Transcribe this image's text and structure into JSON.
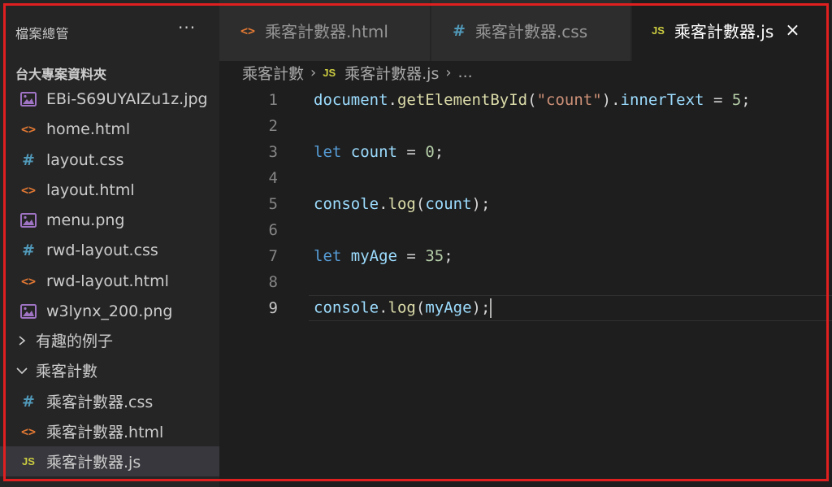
{
  "sidebar": {
    "title": "檔案總管",
    "more_label": "···",
    "root_folder": "台大專案資料夾",
    "items": [
      {
        "label": "EBi-S69UYAIZu1z.jpg",
        "type": "image"
      },
      {
        "label": "home.html",
        "type": "html"
      },
      {
        "label": "layout.css",
        "type": "css"
      },
      {
        "label": "layout.html",
        "type": "html"
      },
      {
        "label": "menu.png",
        "type": "image"
      },
      {
        "label": "rwd-layout.css",
        "type": "css"
      },
      {
        "label": "rwd-layout.html",
        "type": "html"
      },
      {
        "label": "w3lynx_200.png",
        "type": "image"
      },
      {
        "label": "有趣的例子",
        "type": "folder-collapsed"
      },
      {
        "label": "乘客計數",
        "type": "folder-expanded"
      },
      {
        "label": "乘客計數器.css",
        "type": "css"
      },
      {
        "label": "乘客計數器.html",
        "type": "html"
      },
      {
        "label": "乘客計數器.js",
        "type": "js",
        "selected": true
      }
    ]
  },
  "icons": {
    "html": "<>",
    "css": "#",
    "js": "JS",
    "chevron_right": "›",
    "chevron_down": "⌄",
    "close": "×"
  },
  "tabs": [
    {
      "label": "乘客計數器.html",
      "type": "html",
      "active": false
    },
    {
      "label": "乘客計數器.css",
      "type": "css",
      "active": false
    },
    {
      "label": "乘客計數器.js",
      "type": "js",
      "active": true
    }
  ],
  "breadcrumb": {
    "folder": "乘客計數",
    "file": "乘客計數器.js",
    "ellipsis": "..."
  },
  "editor": {
    "current_line": 9,
    "line_numbers": [
      "1",
      "2",
      "3",
      "4",
      "5",
      "6",
      "7",
      "8",
      "9"
    ],
    "lines": [
      [
        {
          "t": "document",
          "c": "var"
        },
        {
          "t": ".",
          "c": "pun"
        },
        {
          "t": "getElementById",
          "c": "fn"
        },
        {
          "t": "(",
          "c": "pun"
        },
        {
          "t": "\"count\"",
          "c": "str"
        },
        {
          "t": ").",
          "c": "pun"
        },
        {
          "t": "innerText",
          "c": "var"
        },
        {
          "t": " = ",
          "c": "pun"
        },
        {
          "t": "5",
          "c": "num"
        },
        {
          "t": ";",
          "c": "pun"
        }
      ],
      [],
      [
        {
          "t": "let",
          "c": "kw"
        },
        {
          "t": " ",
          "c": "pun"
        },
        {
          "t": "count",
          "c": "var"
        },
        {
          "t": " = ",
          "c": "pun"
        },
        {
          "t": "0",
          "c": "num"
        },
        {
          "t": ";",
          "c": "pun"
        }
      ],
      [],
      [
        {
          "t": "console",
          "c": "var"
        },
        {
          "t": ".",
          "c": "pun"
        },
        {
          "t": "log",
          "c": "fn"
        },
        {
          "t": "(",
          "c": "pun"
        },
        {
          "t": "count",
          "c": "var"
        },
        {
          "t": ");",
          "c": "pun"
        }
      ],
      [],
      [
        {
          "t": "let",
          "c": "kw"
        },
        {
          "t": " ",
          "c": "pun"
        },
        {
          "t": "myAge",
          "c": "var"
        },
        {
          "t": " = ",
          "c": "pun"
        },
        {
          "t": "35",
          "c": "num"
        },
        {
          "t": ";",
          "c": "pun"
        }
      ],
      [],
      [
        {
          "t": "console",
          "c": "var"
        },
        {
          "t": ".",
          "c": "pun"
        },
        {
          "t": "log",
          "c": "fn"
        },
        {
          "t": "(",
          "c": "pun"
        },
        {
          "t": "myAge",
          "c": "var"
        },
        {
          "t": ");",
          "c": "pun"
        }
      ]
    ]
  },
  "colors": {
    "editor_bg": "#1e1e1e",
    "sidebar_bg": "#252526",
    "highlight_outline": "#e02020"
  }
}
